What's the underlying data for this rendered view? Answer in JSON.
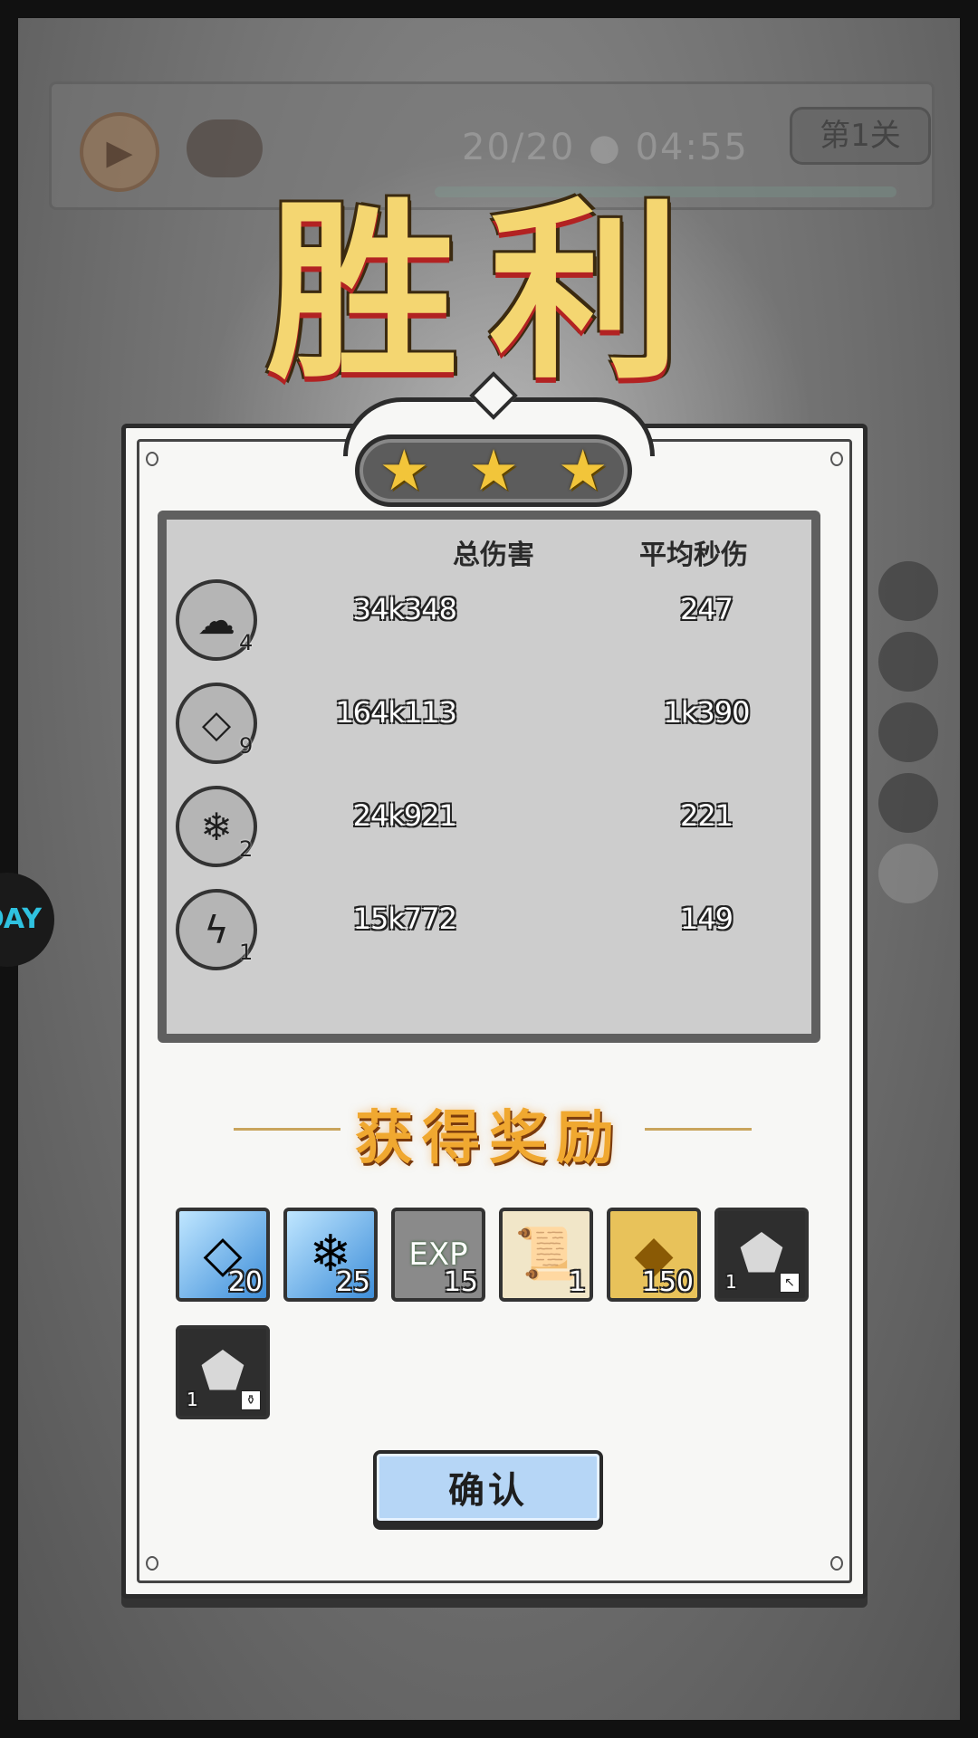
{
  "hud": {
    "timer": "20/20 ● 04:55",
    "level": "第1关",
    "play_icon": "play-icon",
    "drum_icon": "drum-icon"
  },
  "side_badge": {
    "text": "ŁÓAY"
  },
  "victory": {
    "title": "胜利"
  },
  "stars": {
    "earned": 3,
    "total": 3,
    "glyph": "★"
  },
  "stats": {
    "headers": {
      "total_damage": "总伤害",
      "avg_dps": "平均秒伤"
    },
    "rows": [
      {
        "icon": "ink-splash-icon",
        "glyph": "☁",
        "level": "4",
        "total": "34k348",
        "dps": "247"
      },
      {
        "icon": "crystal-shard-icon",
        "glyph": "◇",
        "level": "9",
        "total": "164k113",
        "dps": "1k390"
      },
      {
        "icon": "water-splash-icon",
        "glyph": "❄",
        "level": "2",
        "total": "24k921",
        "dps": "221"
      },
      {
        "icon": "lightning-icon",
        "glyph": "ϟ",
        "level": "1",
        "total": "15k772",
        "dps": "149"
      }
    ]
  },
  "rewards": {
    "title": "获得奖励",
    "items": [
      {
        "icon": "blue-crystal-shard-icon",
        "glyph": "◇",
        "count": "20"
      },
      {
        "icon": "blue-water-crystal-icon",
        "glyph": "❄",
        "count": "25"
      },
      {
        "icon": "exp-orb-icon",
        "glyph": "EXP",
        "count": "15"
      },
      {
        "icon": "scroll-icon",
        "glyph": "📜",
        "count": "1"
      },
      {
        "icon": "gold-coin-icon",
        "glyph": "◆",
        "count": "150"
      },
      {
        "icon": "ore-stone-icon",
        "glyph": "⬟",
        "count": "1"
      },
      {
        "icon": "ore-stone-icon",
        "glyph": "⬟",
        "count": "1"
      }
    ]
  },
  "confirm": {
    "label": "确认"
  },
  "colors": {
    "gold": "#f4d671",
    "reward_orange": "#f0a830",
    "confirm_blue": "#b6d6f6"
  }
}
